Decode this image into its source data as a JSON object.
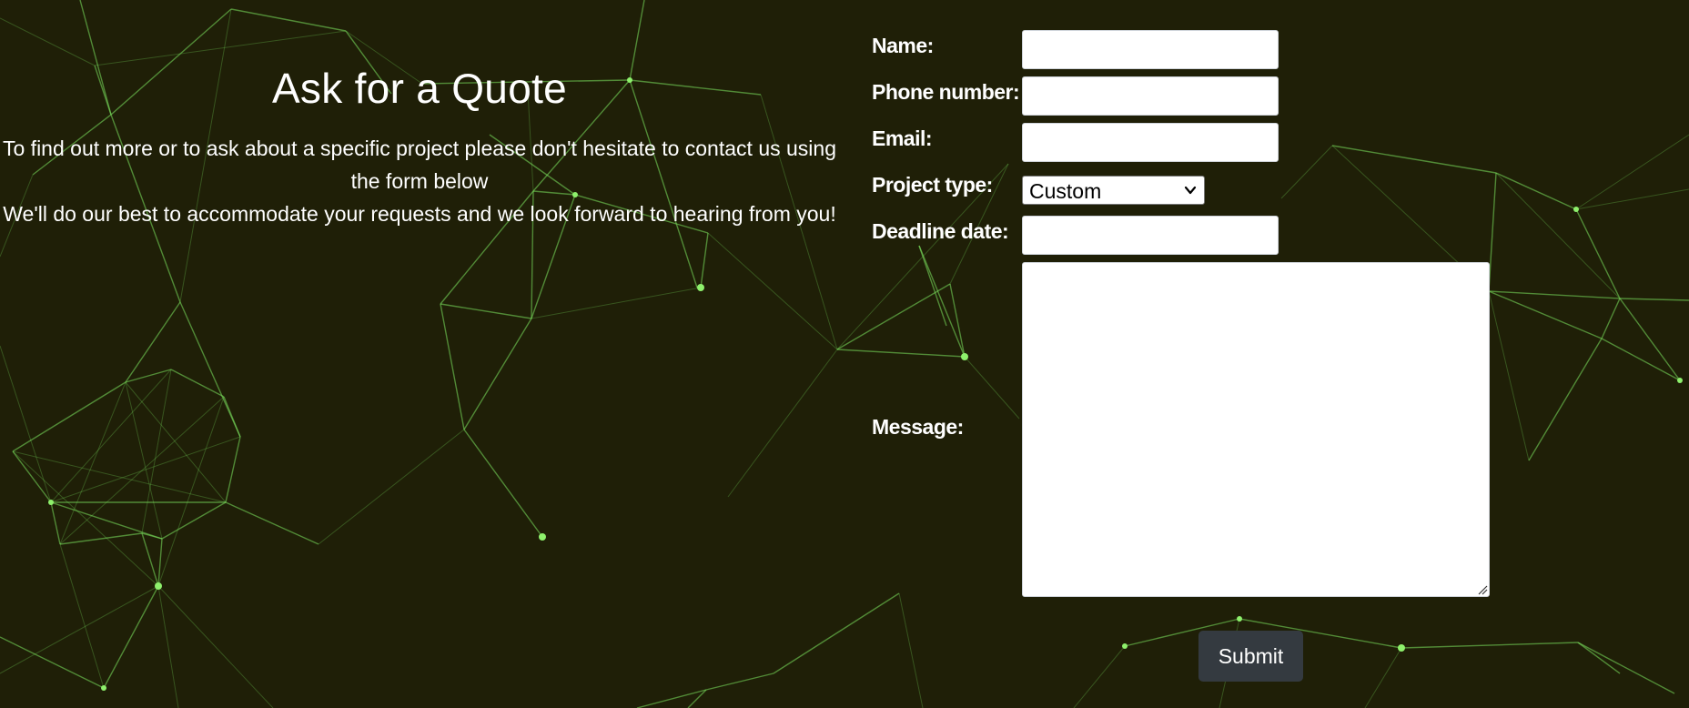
{
  "colors": {
    "background": "#1f1f07",
    "network_line": "#7be35f",
    "submit_button": "#343a40"
  },
  "intro": {
    "title": "Ask for a Quote",
    "paragraph_1": "To find out more or to ask about a specific project please don't hesitate to contact us using the form below",
    "paragraph_2": "We'll do our best to accommodate your requests and we look forward to hearing from you!"
  },
  "form": {
    "name_label": "Name:",
    "name_value": "",
    "phone_label": "Phone number:",
    "phone_value": "",
    "email_label": "Email:",
    "email_value": "",
    "project_type_label": "Project type:",
    "project_type_selected": "Custom",
    "deadline_label": "Deadline date:",
    "deadline_value": "",
    "message_label": "Message:",
    "message_value": "",
    "submit_label": "Submit"
  },
  "icons": {
    "select_arrow": "chevron-down-icon",
    "textarea_resize": "resize-handle-icon"
  }
}
